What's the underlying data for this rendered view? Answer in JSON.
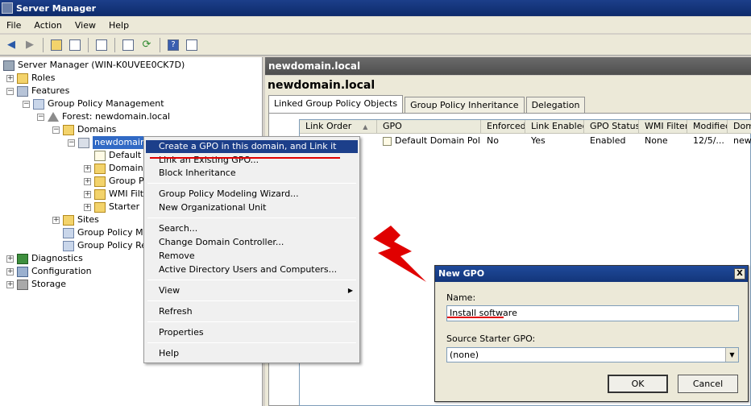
{
  "window": {
    "title": "Server Manager"
  },
  "menu": [
    "File",
    "Action",
    "View",
    "Help"
  ],
  "toolbar": {
    "icons": [
      "back-arrow-icon",
      "forward-arrow-icon",
      "up-folder-icon",
      "show-tree-icon",
      "properties-icon",
      "export-list-icon",
      "refresh-icon",
      "help-icon",
      "action-pane-icon"
    ]
  },
  "tree": {
    "root": "Server Manager (WIN-K0UVEE0CK7D)",
    "roles": "Roles",
    "features": "Features",
    "gpm": "Group Policy Management",
    "forest": "Forest: newdomain.local",
    "domains": "Domains",
    "newdomain": "newdomain.l",
    "default": "Default",
    "domain_ctrl": "Domain",
    "gp_objects": "Group P",
    "wmi": "WMI Filt",
    "starter": "Starter",
    "sites": "Sites",
    "gp_modeling": "Group Policy Mo",
    "gp_results": "Group Policy Re",
    "diagnostics": "Diagnostics",
    "configuration": "Configuration",
    "storage": "Storage"
  },
  "right": {
    "header": "newdomain.local",
    "title": "newdomain.local",
    "tabs": [
      "Linked Group Policy Objects",
      "Group Policy Inheritance",
      "Delegation"
    ],
    "columns": [
      "Link Order",
      "GPO",
      "Enforced",
      "Link Enabled",
      "GPO Status",
      "WMI Filter",
      "Modified",
      "Dom"
    ],
    "row": {
      "gpo": "Default Domain Policy",
      "enforced": "No",
      "link_enabled": "Yes",
      "status": "Enabled",
      "wmi": "None",
      "modified": "12/5/...",
      "domain": "newd"
    }
  },
  "context_menu": {
    "items": [
      "Create a GPO in this domain, and Link it here...",
      "Link an Existing GPO...",
      "Block Inheritance",
      "Group Policy Modeling Wizard...",
      "New Organizational Unit",
      "Search...",
      "Change Domain Controller...",
      "Remove",
      "Active Directory Users and Computers...",
      "View",
      "Refresh",
      "Properties",
      "Help"
    ]
  },
  "dialog": {
    "title": "New GPO",
    "close": "X",
    "name_label": "Name:",
    "name_value": "Install software",
    "starter_label": "Source Starter GPO:",
    "starter_value": "(none)",
    "ok": "OK",
    "cancel": "Cancel"
  },
  "colors": {
    "accent": "#1c3f8a",
    "annotation": "#e00000"
  }
}
